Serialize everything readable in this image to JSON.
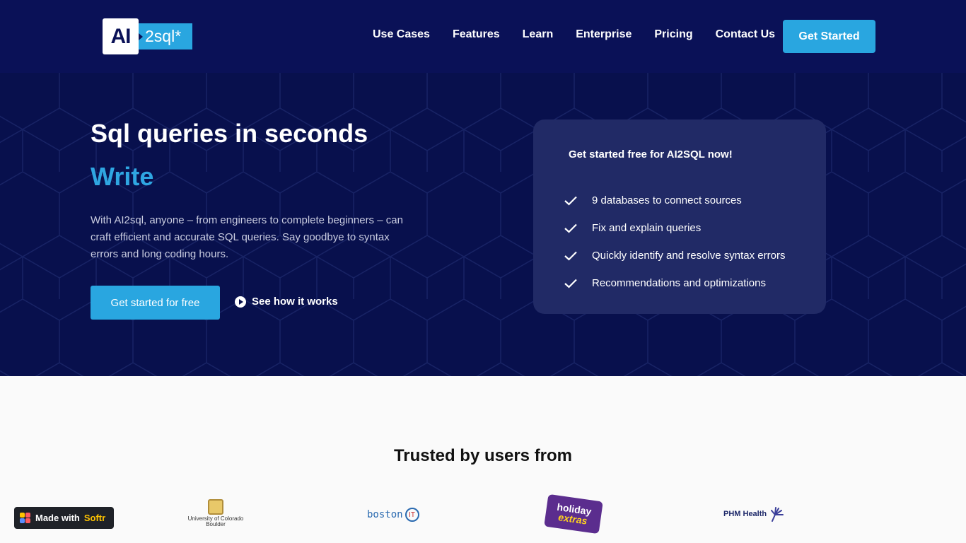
{
  "header": {
    "logo": {
      "ai": "AI",
      "suffix": "2sql*"
    },
    "nav": [
      {
        "label": "Use Cases"
      },
      {
        "label": "Features"
      },
      {
        "label": "Learn"
      },
      {
        "label": "Enterprise"
      },
      {
        "label": "Pricing"
      },
      {
        "label": "Contact Us"
      }
    ],
    "cta_label": "Get Started"
  },
  "hero": {
    "title": "Sql queries in seconds",
    "highlight": "Write",
    "description": "With AI2sql, anyone – from engineers to complete beginners – can craft efficient and accurate SQL queries. Say goodbye to syntax errors and long coding hours.",
    "primary_button": "Get started for free",
    "secondary_button": "See how it works"
  },
  "card": {
    "title": "Get started free for AI2SQL now!",
    "items": [
      {
        "text": "9 databases to connect sources"
      },
      {
        "text": "Fix and explain queries"
      },
      {
        "text": "Quickly identify and resolve syntax errors"
      },
      {
        "text": "Recommendations and optimizations"
      }
    ]
  },
  "trusted": {
    "title": "Trusted by users from",
    "logos": {
      "colorado": "University of Colorado Boulder",
      "boston": "boston",
      "boston_mark": "IT",
      "holiday_1": "holiday",
      "holiday_2": "extras",
      "phm": "PHM Health"
    }
  },
  "badge": {
    "prefix": "Made with",
    "brand": "Softr"
  },
  "colors": {
    "header_bg": "#0a1157",
    "hero_bg": "#08104d",
    "accent": "#29a6e0",
    "card_bg": "#212a66"
  }
}
